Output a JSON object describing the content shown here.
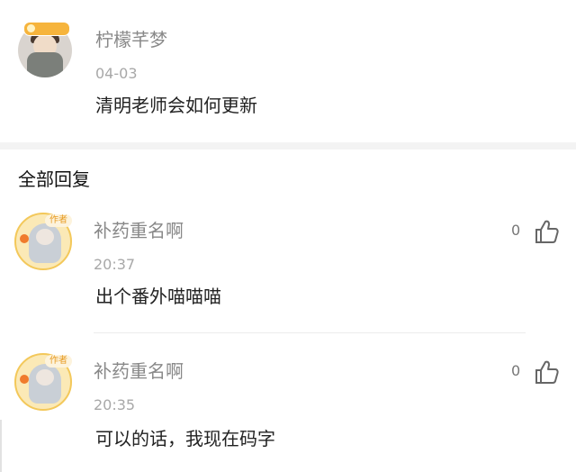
{
  "post": {
    "author": "柠檬芊梦",
    "date": "04-03",
    "content": "清明老师会如何更新"
  },
  "section_title": "全部回复",
  "replies": [
    {
      "author": "补药重名啊",
      "tag": "作者",
      "time": "20:37",
      "content": "出个番外喵喵喵",
      "likes": "0"
    },
    {
      "author": "补药重名啊",
      "tag": "作者",
      "time": "20:35",
      "content": "可以的话，我现在码字",
      "likes": "0"
    }
  ],
  "icons": {
    "like": "thumbs-up-icon"
  }
}
